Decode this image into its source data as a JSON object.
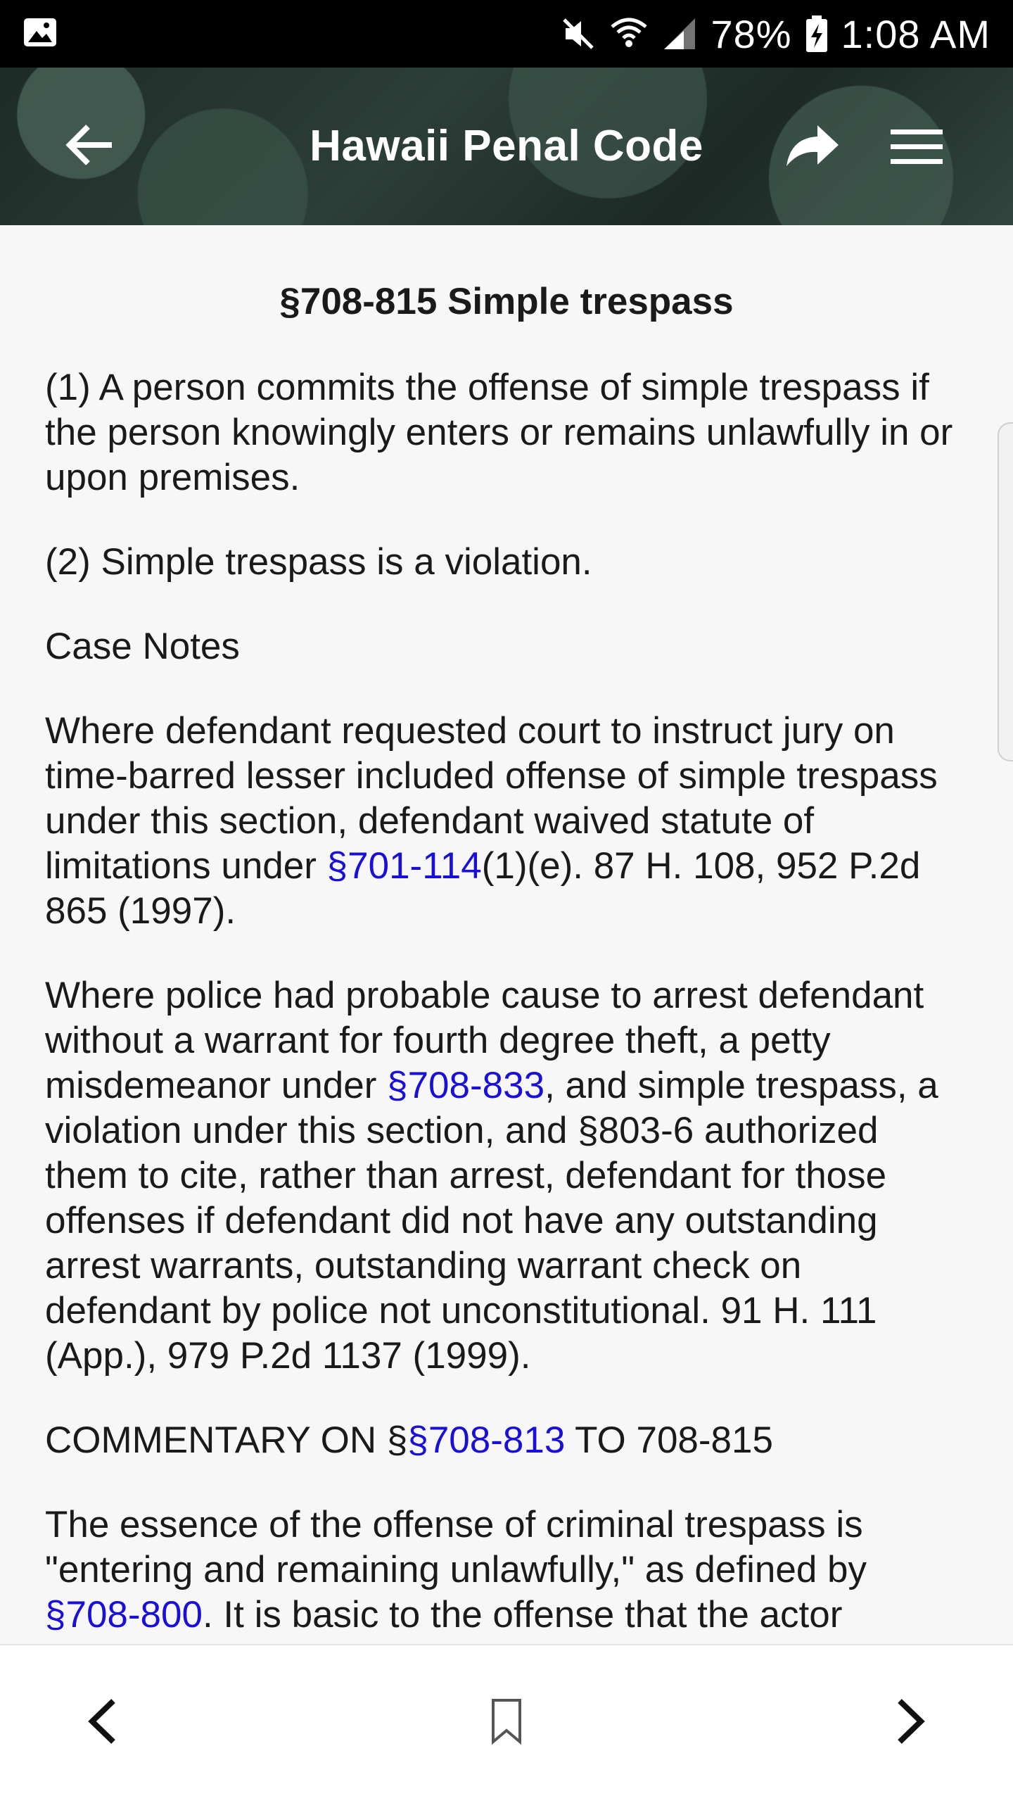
{
  "status_bar": {
    "battery": "78%",
    "time": "1:08 AM",
    "icons": [
      "image-icon",
      "mute-icon",
      "wifi-icon",
      "signal-icon",
      "battery-charging-icon"
    ]
  },
  "app_bar": {
    "title": "Hawaii Penal Code",
    "icons": [
      "back-arrow-icon",
      "share-icon",
      "hamburger-menu-icon"
    ]
  },
  "section": {
    "heading": "§708-815 Simple trespass",
    "p1": "(1) A person commits the offense of simple trespass if the person knowingly enters or remains unlawfully in or upon premises.",
    "p2": "(2) Simple trespass is a violation.",
    "case_notes_label": "Case Notes",
    "note1_before": "Where defendant requested court to instruct jury on time-barred lesser included offense of simple trespass under this section, defendant waived statute of limitations under ",
    "note1_link": "§701-114",
    "note1_after": "(1)(e). 87 H. 108, 952 P.2d 865 (1997).",
    "note2_before": "Where police had probable cause to arrest defendant without a warrant for fourth degree theft, a petty misdemeanor under ",
    "note2_link": "§708-833",
    "note2_after": ", and simple trespass, a violation under this section, and §803-6 authorized them to cite, rather than arrest, defendant for those offenses if defendant did not have any outstanding arrest warrants, outstanding warrant check on defendant by police not unconstitutional. 91 H. 111 (App.), 979 P.2d 1137 (1999).",
    "commentary_before": "COMMENTARY ON §",
    "commentary_link": "§708-813",
    "commentary_after": " TO 708-815",
    "essence_before": "The essence of the offense of criminal trespass is \"entering and remaining unlawfully,\" as defined by ",
    "essence_link": "§708-800",
    "essence_after": ". It is basic to the offense that the actor"
  },
  "bottom_nav": {
    "icons": [
      "chevron-left-icon",
      "bookmark-icon",
      "chevron-right-icon"
    ]
  },
  "colors": {
    "link": "#1a0fd6",
    "text": "#1a1a1a",
    "background": "#f7f7f7",
    "status_bar": "#000000"
  }
}
